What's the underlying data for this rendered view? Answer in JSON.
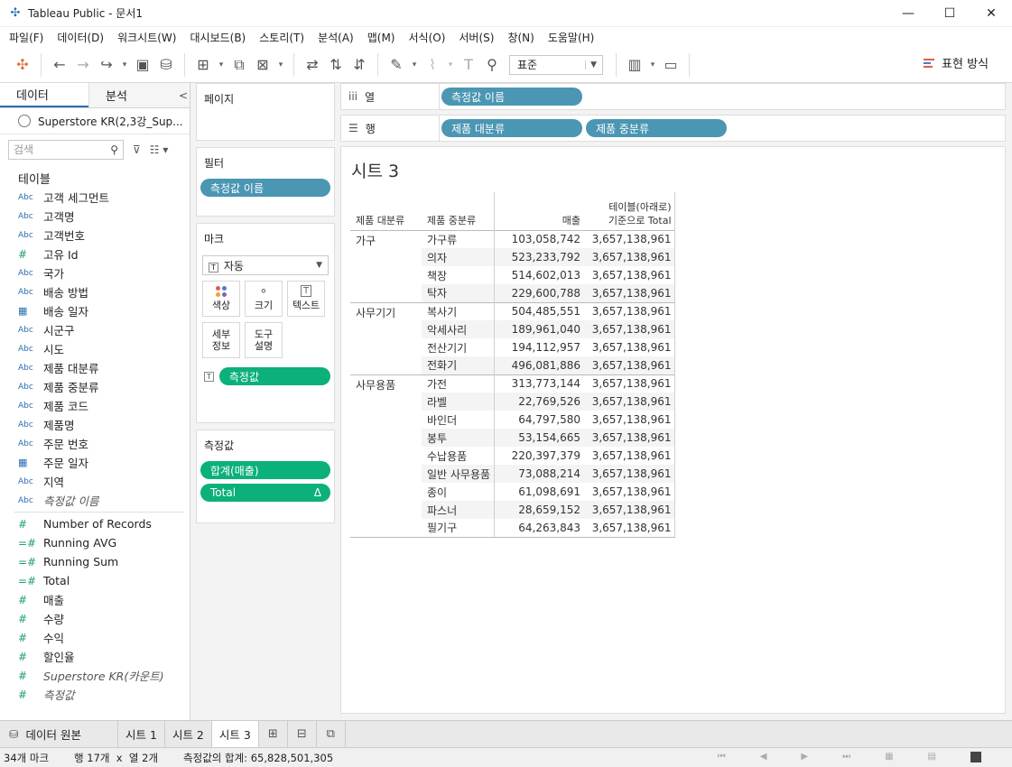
{
  "window": {
    "title": "Tableau Public - 문서1",
    "minimize": "—",
    "maximize": "☐",
    "close": "✕"
  },
  "menu": [
    "파일(F)",
    "데이터(D)",
    "워크시트(W)",
    "대시보드(B)",
    "스토리(T)",
    "분석(A)",
    "맵(M)",
    "서식(O)",
    "서버(S)",
    "창(N)",
    "도움말(H)"
  ],
  "toolbar": {
    "fit_select": "표준",
    "show_me": "표현 방식"
  },
  "data_pane": {
    "tab_data": "데이터",
    "tab_analysis": "분석",
    "collapse": "<",
    "datasource": "Superstore KR(2,3강_Sup...",
    "search_placeholder": "검색",
    "tables_header": "테이블",
    "dimensions": [
      {
        "type": "Abc",
        "name": "고객 세그먼트"
      },
      {
        "type": "Abc",
        "name": "고객명"
      },
      {
        "type": "Abc",
        "name": "고객번호"
      },
      {
        "type": "#",
        "name": "고유 Id"
      },
      {
        "type": "Abc",
        "name": "국가"
      },
      {
        "type": "Abc",
        "name": "배송 방법"
      },
      {
        "type": "date",
        "name": "배송 일자"
      },
      {
        "type": "Abc",
        "name": "시군구"
      },
      {
        "type": "Abc",
        "name": "시도"
      },
      {
        "type": "Abc",
        "name": "제품 대분류"
      },
      {
        "type": "Abc",
        "name": "제품 중분류"
      },
      {
        "type": "Abc",
        "name": "제품 코드"
      },
      {
        "type": "Abc",
        "name": "제품명"
      },
      {
        "type": "Abc",
        "name": "주문 번호"
      },
      {
        "type": "date",
        "name": "주문 일자"
      },
      {
        "type": "Abc",
        "name": "지역"
      },
      {
        "type": "Abc",
        "name": "측정값 이름",
        "italic": true
      }
    ],
    "measures": [
      {
        "type": "#",
        "name": "Number of Records"
      },
      {
        "type": "=#",
        "name": "Running AVG"
      },
      {
        "type": "=#",
        "name": "Running Sum"
      },
      {
        "type": "=#",
        "name": "Total"
      },
      {
        "type": "#",
        "name": "매출"
      },
      {
        "type": "#",
        "name": "수량"
      },
      {
        "type": "#",
        "name": "수익"
      },
      {
        "type": "#",
        "name": "할인율"
      },
      {
        "type": "#",
        "name": "Superstore KR(카운트)",
        "italic": true
      },
      {
        "type": "#",
        "name": "측정값",
        "italic": true
      }
    ]
  },
  "cards": {
    "pages": "페이지",
    "filters": "필터",
    "filter_pill": "측정값 이름",
    "marks": "마크",
    "mark_type": "자동",
    "mark_buttons": {
      "color": "색상",
      "size": "크기",
      "text": "텍스트",
      "detail": "세부\n정보",
      "tooltip": "도구\n설명"
    },
    "marks_pill": "측정값",
    "measure_values": "측정값",
    "mv_pills": [
      "합계(매출)",
      "Total"
    ]
  },
  "shelves": {
    "columns_label": "열",
    "rows_label": "행",
    "columns_pills": [
      "측정값 이름"
    ],
    "rows_pills": [
      "제품 대분류",
      "제품 중분류"
    ]
  },
  "sheet": {
    "title": "시트 3",
    "headers": {
      "c1": "제품 대분류",
      "c2": "제품 중분류",
      "c3": "매출",
      "c4a": "테이블(아래로)",
      "c4b": "기준으로 Total"
    },
    "groups": [
      {
        "name": "가구",
        "rows": [
          {
            "sub": "가구류",
            "sales": "103,058,742",
            "total": "3,657,138,961"
          },
          {
            "sub": "의자",
            "sales": "523,233,792",
            "total": "3,657,138,961"
          },
          {
            "sub": "책장",
            "sales": "514,602,013",
            "total": "3,657,138,961"
          },
          {
            "sub": "탁자",
            "sales": "229,600,788",
            "total": "3,657,138,961"
          }
        ]
      },
      {
        "name": "사무기기",
        "rows": [
          {
            "sub": "복사기",
            "sales": "504,485,551",
            "total": "3,657,138,961"
          },
          {
            "sub": "악세사리",
            "sales": "189,961,040",
            "total": "3,657,138,961"
          },
          {
            "sub": "전산기기",
            "sales": "194,112,957",
            "total": "3,657,138,961"
          },
          {
            "sub": "전화기",
            "sales": "496,081,886",
            "total": "3,657,138,961"
          }
        ]
      },
      {
        "name": "사무용품",
        "rows": [
          {
            "sub": "가전",
            "sales": "313,773,144",
            "total": "3,657,138,961"
          },
          {
            "sub": "라벨",
            "sales": "22,769,526",
            "total": "3,657,138,961"
          },
          {
            "sub": "바인더",
            "sales": "64,797,580",
            "total": "3,657,138,961"
          },
          {
            "sub": "봉투",
            "sales": "53,154,665",
            "total": "3,657,138,961"
          },
          {
            "sub": "수납용품",
            "sales": "220,397,379",
            "total": "3,657,138,961"
          },
          {
            "sub": "일반 사무용품",
            "sales": "73,088,214",
            "total": "3,657,138,961"
          },
          {
            "sub": "종이",
            "sales": "61,098,691",
            "total": "3,657,138,961"
          },
          {
            "sub": "파스너",
            "sales": "28,659,152",
            "total": "3,657,138,961"
          },
          {
            "sub": "필기구",
            "sales": "64,263,843",
            "total": "3,657,138,961"
          }
        ]
      }
    ]
  },
  "tabs": {
    "datasource": "데이터 원본",
    "sheets": [
      "시트 1",
      "시트 2",
      "시트 3"
    ],
    "active": "시트 3"
  },
  "status": {
    "marks": "34개 마크",
    "rows_cols": "행 17개  x  열 2개",
    "sum": "측정값의 합계: 65,828,501,305"
  },
  "colors": {
    "dim_pill": "#4a96b3",
    "measure_pill": "#0cb07b"
  }
}
